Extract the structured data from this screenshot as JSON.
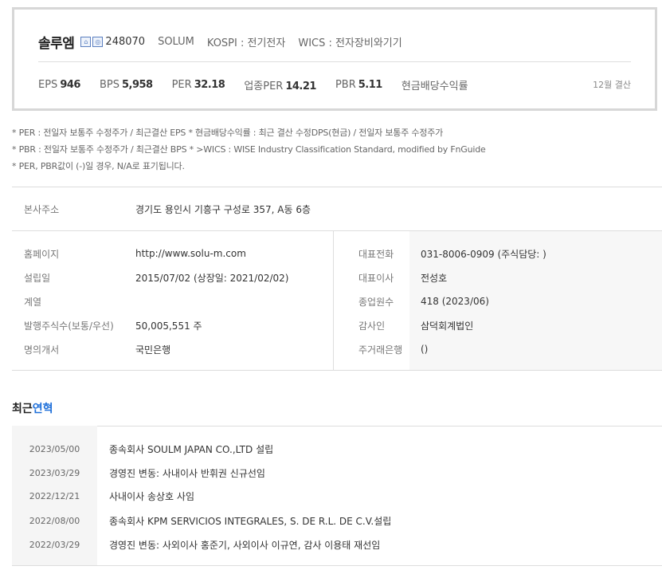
{
  "company": {
    "name": "솔루엠",
    "icons": [
      "home-icon",
      "ir-icon"
    ],
    "code": "248070",
    "english_name": "SOLUM",
    "market": "KOSPI : 전기전자",
    "wics": "WICS : 전자장비와기기"
  },
  "metrics": [
    {
      "label": "EPS",
      "value": "946"
    },
    {
      "label": "BPS",
      "value": "5,958"
    },
    {
      "label": "PER",
      "value": "32.18"
    },
    {
      "label": "업종PER",
      "value": "14.21"
    },
    {
      "label": "PBR",
      "value": "5.11"
    },
    {
      "label": "현금배당수익률",
      "value": ""
    }
  ],
  "close_basis": "12월 결산",
  "notes": [
    "* PER : 전일자 보통주 수정주가 / 최근결산 EPS * 현금배당수익률 : 최근 결산 수정DPS(현금) / 전일자 보통주 수정주가",
    "* PBR : 전일자 보통주 수정주가 / 최근결산 BPS * >WICS : WISE Industry Classification Standard, modified by FnGuide",
    "* PER, PBR값이 (-)일 경우, N/A로 표기됩니다."
  ],
  "address": {
    "label": "본사주소",
    "value": "경기도 용인시 기흥구 구성로 357, A동 6층"
  },
  "info_left": [
    {
      "label": "홈페이지",
      "value": "http://www.solu-m.com"
    },
    {
      "label": "설립일",
      "value": "2015/07/02 (상장일: 2021/02/02)"
    },
    {
      "label": "계열",
      "value": ""
    },
    {
      "label": "발행주식수(보통/우선)",
      "value": "50,005,551 주"
    },
    {
      "label": "명의개서",
      "value": "국민은행"
    }
  ],
  "info_right": [
    {
      "label": "대표전화",
      "value": "031-8006-0909 (주식담당: )"
    },
    {
      "label": "대표이사",
      "value": "전성호"
    },
    {
      "label": "종업원수",
      "value": "418 (2023/06)"
    },
    {
      "label": "감사인",
      "value": "삼덕회계법인"
    },
    {
      "label": "주거래은행",
      "value": "()"
    }
  ],
  "history_title": {
    "prefix": "최근",
    "accent": "연혁"
  },
  "history": [
    {
      "date": "2023/05/00",
      "text": "종속회사 SOULM JAPAN CO.,LTD 설립"
    },
    {
      "date": "2023/03/29",
      "text": "경영진 변동: 사내이사 반휘권 신규선임"
    },
    {
      "date": "2022/12/21",
      "text": "사내이사 송상호 사임"
    },
    {
      "date": "2022/08/00",
      "text": "종속회사 KPM SERVICIOS INTEGRALES, S. DE R.L. DE C.V.설립"
    },
    {
      "date": "2022/03/29",
      "text": "경영진 변동: 사외이사 홍준기, 사외이사 이규연, 감사 이용태 재선임"
    }
  ]
}
